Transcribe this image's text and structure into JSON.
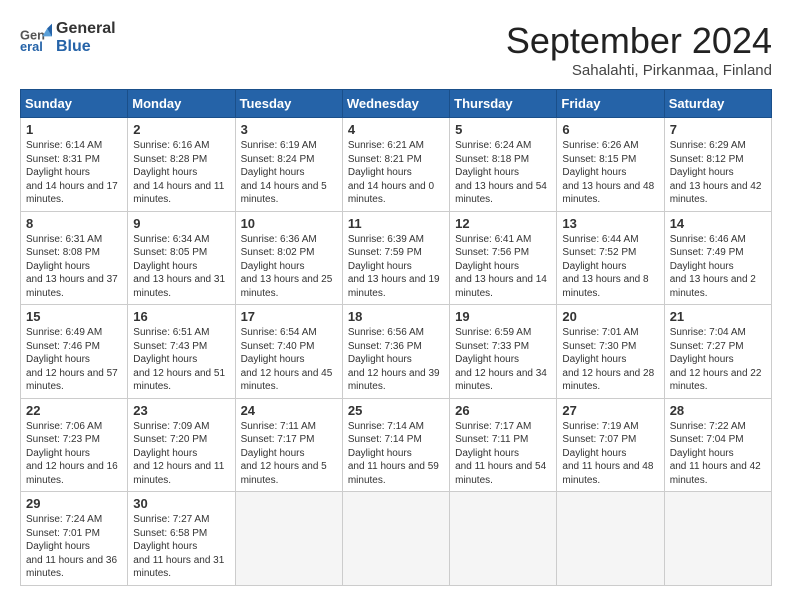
{
  "header": {
    "logo_general": "General",
    "logo_blue": "Blue",
    "month_title": "September 2024",
    "location": "Sahalahti, Pirkanmaa, Finland"
  },
  "days_of_week": [
    "Sunday",
    "Monday",
    "Tuesday",
    "Wednesday",
    "Thursday",
    "Friday",
    "Saturday"
  ],
  "weeks": [
    [
      {
        "day": 1,
        "sunrise": "6:14 AM",
        "sunset": "8:31 PM",
        "daylight": "14 hours and 17 minutes."
      },
      {
        "day": 2,
        "sunrise": "6:16 AM",
        "sunset": "8:28 PM",
        "daylight": "14 hours and 11 minutes."
      },
      {
        "day": 3,
        "sunrise": "6:19 AM",
        "sunset": "8:24 PM",
        "daylight": "14 hours and 5 minutes."
      },
      {
        "day": 4,
        "sunrise": "6:21 AM",
        "sunset": "8:21 PM",
        "daylight": "14 hours and 0 minutes."
      },
      {
        "day": 5,
        "sunrise": "6:24 AM",
        "sunset": "8:18 PM",
        "daylight": "13 hours and 54 minutes."
      },
      {
        "day": 6,
        "sunrise": "6:26 AM",
        "sunset": "8:15 PM",
        "daylight": "13 hours and 48 minutes."
      },
      {
        "day": 7,
        "sunrise": "6:29 AM",
        "sunset": "8:12 PM",
        "daylight": "13 hours and 42 minutes."
      }
    ],
    [
      {
        "day": 8,
        "sunrise": "6:31 AM",
        "sunset": "8:08 PM",
        "daylight": "13 hours and 37 minutes."
      },
      {
        "day": 9,
        "sunrise": "6:34 AM",
        "sunset": "8:05 PM",
        "daylight": "13 hours and 31 minutes."
      },
      {
        "day": 10,
        "sunrise": "6:36 AM",
        "sunset": "8:02 PM",
        "daylight": "13 hours and 25 minutes."
      },
      {
        "day": 11,
        "sunrise": "6:39 AM",
        "sunset": "7:59 PM",
        "daylight": "13 hours and 19 minutes."
      },
      {
        "day": 12,
        "sunrise": "6:41 AM",
        "sunset": "7:56 PM",
        "daylight": "13 hours and 14 minutes."
      },
      {
        "day": 13,
        "sunrise": "6:44 AM",
        "sunset": "7:52 PM",
        "daylight": "13 hours and 8 minutes."
      },
      {
        "day": 14,
        "sunrise": "6:46 AM",
        "sunset": "7:49 PM",
        "daylight": "13 hours and 2 minutes."
      }
    ],
    [
      {
        "day": 15,
        "sunrise": "6:49 AM",
        "sunset": "7:46 PM",
        "daylight": "12 hours and 57 minutes."
      },
      {
        "day": 16,
        "sunrise": "6:51 AM",
        "sunset": "7:43 PM",
        "daylight": "12 hours and 51 minutes."
      },
      {
        "day": 17,
        "sunrise": "6:54 AM",
        "sunset": "7:40 PM",
        "daylight": "12 hours and 45 minutes."
      },
      {
        "day": 18,
        "sunrise": "6:56 AM",
        "sunset": "7:36 PM",
        "daylight": "12 hours and 39 minutes."
      },
      {
        "day": 19,
        "sunrise": "6:59 AM",
        "sunset": "7:33 PM",
        "daylight": "12 hours and 34 minutes."
      },
      {
        "day": 20,
        "sunrise": "7:01 AM",
        "sunset": "7:30 PM",
        "daylight": "12 hours and 28 minutes."
      },
      {
        "day": 21,
        "sunrise": "7:04 AM",
        "sunset": "7:27 PM",
        "daylight": "12 hours and 22 minutes."
      }
    ],
    [
      {
        "day": 22,
        "sunrise": "7:06 AM",
        "sunset": "7:23 PM",
        "daylight": "12 hours and 16 minutes."
      },
      {
        "day": 23,
        "sunrise": "7:09 AM",
        "sunset": "7:20 PM",
        "daylight": "12 hours and 11 minutes."
      },
      {
        "day": 24,
        "sunrise": "7:11 AM",
        "sunset": "7:17 PM",
        "daylight": "12 hours and 5 minutes."
      },
      {
        "day": 25,
        "sunrise": "7:14 AM",
        "sunset": "7:14 PM",
        "daylight": "11 hours and 59 minutes."
      },
      {
        "day": 26,
        "sunrise": "7:17 AM",
        "sunset": "7:11 PM",
        "daylight": "11 hours and 54 minutes."
      },
      {
        "day": 27,
        "sunrise": "7:19 AM",
        "sunset": "7:07 PM",
        "daylight": "11 hours and 48 minutes."
      },
      {
        "day": 28,
        "sunrise": "7:22 AM",
        "sunset": "7:04 PM",
        "daylight": "11 hours and 42 minutes."
      }
    ],
    [
      {
        "day": 29,
        "sunrise": "7:24 AM",
        "sunset": "7:01 PM",
        "daylight": "11 hours and 36 minutes."
      },
      {
        "day": 30,
        "sunrise": "7:27 AM",
        "sunset": "6:58 PM",
        "daylight": "11 hours and 31 minutes."
      },
      null,
      null,
      null,
      null,
      null
    ]
  ]
}
